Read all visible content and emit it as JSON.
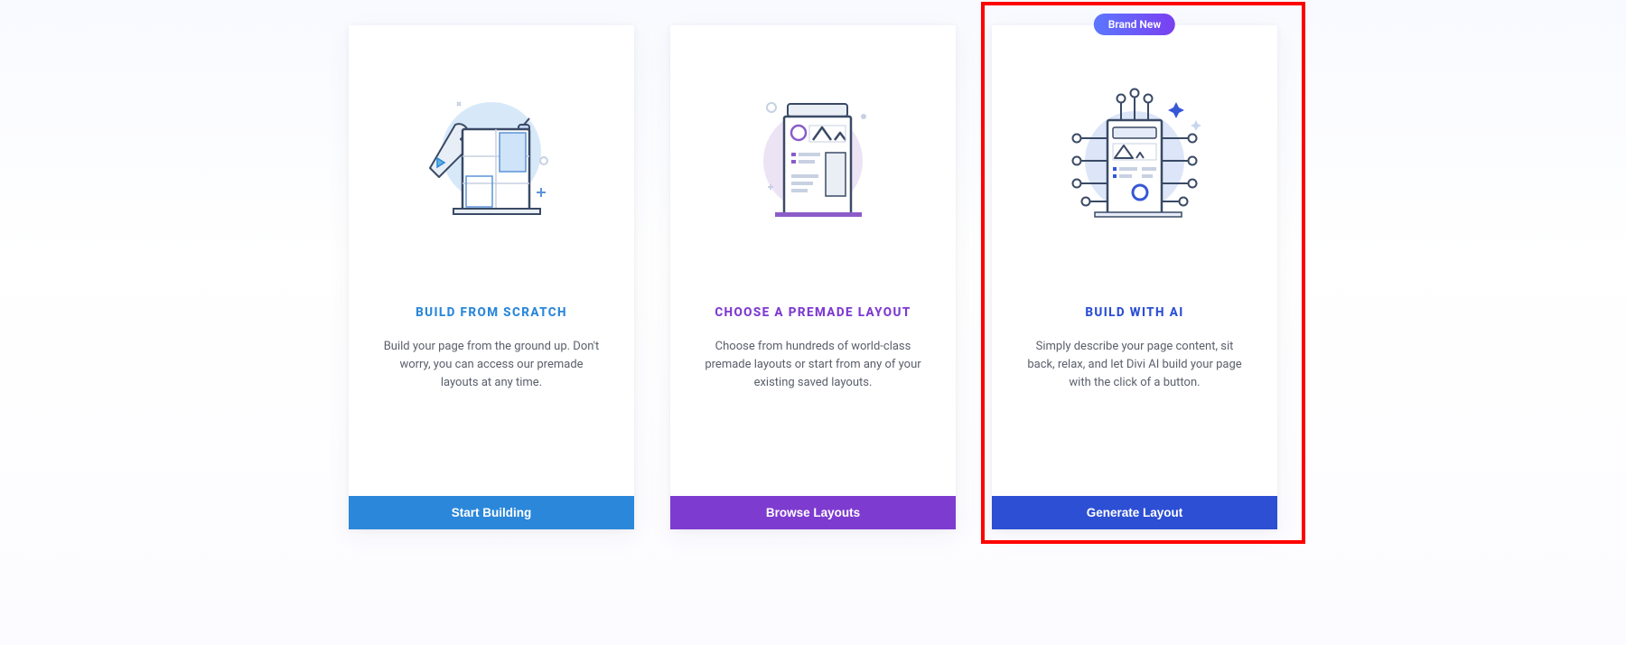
{
  "cards": [
    {
      "title": "BUILD FROM SCRATCH",
      "desc": "Build your page from the ground up. Don't worry, you can access our premade layouts at any time.",
      "button": "Start Building"
    },
    {
      "title": "CHOOSE A PREMADE LAYOUT",
      "desc": "Choose from hundreds of world-class premade layouts or start from any of your existing saved layouts.",
      "button": "Browse Layouts"
    },
    {
      "badge": "Brand New",
      "title": "BUILD WITH AI",
      "desc": "Simply describe your page content, sit back, relax, and let Divi AI build your page with the click of a button.",
      "button": "Generate Layout"
    }
  ]
}
